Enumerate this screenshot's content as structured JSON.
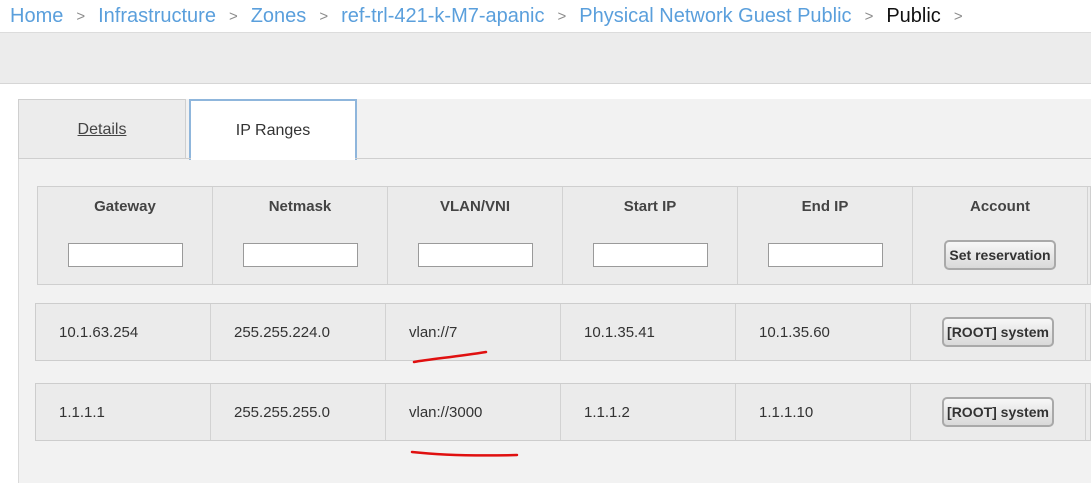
{
  "breadcrumb": {
    "items": [
      "Home",
      "Infrastructure",
      "Zones",
      "ref-trl-421-k-M7-apanic",
      "Physical Network Guest Public"
    ],
    "current": "Public",
    "separator": ">"
  },
  "tabs": [
    {
      "label": "Details",
      "active": false
    },
    {
      "label": "IP Ranges",
      "active": true
    }
  ],
  "table": {
    "columns": [
      "Gateway",
      "Netmask",
      "VLAN/VNI",
      "Start IP",
      "End IP",
      "Account"
    ],
    "form": {
      "gateway": "",
      "netmask": "",
      "vlan": "",
      "start_ip": "",
      "end_ip": "",
      "reservation_button": "Set reservation"
    },
    "rows": [
      {
        "gateway": "10.1.63.254",
        "netmask": "255.255.224.0",
        "vlan": "vlan://7",
        "start_ip": "10.1.35.41",
        "end_ip": "10.1.35.60",
        "account": "[ROOT] system"
      },
      {
        "gateway": "1.1.1.1",
        "netmask": "255.255.255.0",
        "vlan": "vlan://3000",
        "start_ip": "1.1.1.2",
        "end_ip": "1.1.1.10",
        "account": "[ROOT] system"
      }
    ]
  },
  "colors": {
    "link": "#5a9fdc",
    "annotation": "#e01010",
    "active_tab_border": "#8fb6dc"
  }
}
